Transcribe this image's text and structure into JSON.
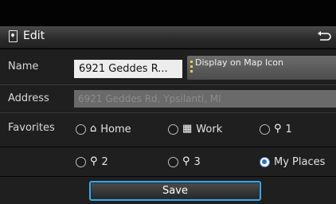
{
  "header": {
    "title": "Edit",
    "edit_icon": "edit-document-icon",
    "back_icon": "back-arrow-icon"
  },
  "form": {
    "name_label": "Name",
    "name_value": "6921 Geddes R...",
    "display_button": "Display on Map Icon",
    "address_label": "Address",
    "address_value": "6921 Geddes Rd, Ypsilanti, MI",
    "favorites_label": "Favorites"
  },
  "favorites": {
    "options": [
      {
        "icon": "home-icon",
        "label": "Home",
        "selected": false
      },
      {
        "icon": "work-icon",
        "label": "Work",
        "selected": false
      },
      {
        "icon": "favorite-key-icon",
        "label": "1",
        "selected": false
      },
      {
        "icon": "favorite-key-icon",
        "label": "2",
        "selected": false
      },
      {
        "icon": "favorite-key-icon",
        "label": "3",
        "selected": false
      },
      {
        "icon": "",
        "label": "My Places",
        "selected": true
      }
    ]
  },
  "actions": {
    "save_label": "Save"
  },
  "colors": {
    "accent": "#3fa7e0",
    "radio_selected": "#2f6fc8",
    "display_marker": "#f7c94f"
  }
}
